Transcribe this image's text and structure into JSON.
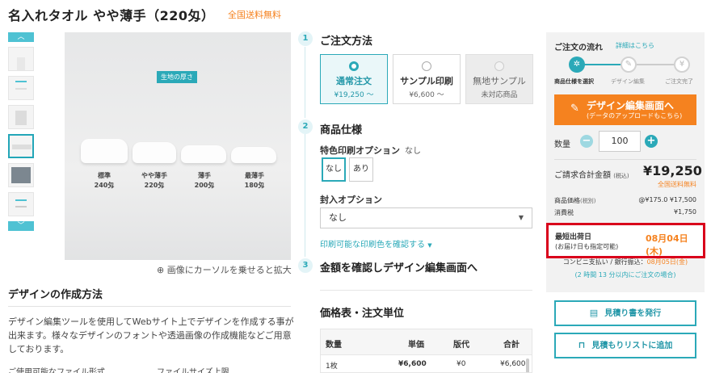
{
  "title": "名入れタオル やや薄手（220匁）",
  "free_shipping": "全国送料無料",
  "thumbnails": {
    "up": "︿",
    "down": "﹀"
  },
  "image": {
    "label": "生地の厚さ",
    "towels": [
      {
        "name": "標準",
        "weight": "240匁"
      },
      {
        "name": "やや薄手",
        "weight": "220匁"
      },
      {
        "name": "薄手",
        "weight": "200匁"
      },
      {
        "name": "最薄手",
        "weight": "180匁"
      }
    ],
    "zoom_hint": "画像にカーソルを乗せると拡大"
  },
  "design": {
    "title": "デザインの作成方法",
    "text": "デザイン編集ツールを使用してWebサイト上でデザインを作成する事が出来ます。様々なデザインのフォントや透過画像の作成機能などご用意しております。",
    "formats_label": "ご使用可能なファイル形式",
    "size_label": "ファイルサイズ上限"
  },
  "steps": [
    {
      "num": "1",
      "title": "ご注文方法"
    },
    {
      "num": "2",
      "title": "商品仕様"
    },
    {
      "num": "3",
      "title": "金額を確認しデザイン編集画面へ"
    }
  ],
  "order_methods": [
    {
      "name": "通常注文",
      "price": "¥19,250 〜"
    },
    {
      "name": "サンプル印刷",
      "price": "¥6,600 〜"
    },
    {
      "name": "無地サンプル",
      "price": "未対応商品"
    }
  ],
  "special_print": {
    "label": "特色印刷オプション",
    "note": "なし",
    "options": [
      "なし",
      "あり"
    ]
  },
  "enclose": {
    "label": "封入オプション",
    "value": "なし"
  },
  "color_link": "印刷可能な印刷色を確認する",
  "price_table": {
    "title": "価格表・注文単位",
    "headers": [
      "数量",
      "単価",
      "版代",
      "合計"
    ],
    "rows": [
      [
        "1枚",
        "¥6,600",
        "¥0",
        "¥6,600"
      ]
    ]
  },
  "flow": {
    "title": "ご注文の流れ",
    "link": "詳細はこちら",
    "steps": [
      "商品仕様を選択",
      "デザイン編集",
      "ご注文完了"
    ],
    "icons": [
      "✲",
      "✎",
      "¥"
    ]
  },
  "design_button": {
    "line1": "デザイン編集画面へ",
    "line2": "(データのアップロードもこちら)",
    "icon": "✎"
  },
  "quantity": {
    "label": "数量",
    "value": "100",
    "minus": "−",
    "plus": "+"
  },
  "total": {
    "label": "ご請求合計金額",
    "tax": "(税込)",
    "value": "¥19,250",
    "shipping": "全国送料無料"
  },
  "price_item": {
    "label": "商品価格",
    "tax": "(税別)",
    "value": "@¥175.0 ¥17,500"
  },
  "consumption_tax": {
    "label": "消費税",
    "value": "¥1,750"
  },
  "shipping_date": {
    "label": "最短出荷日",
    "sub": "(お届け日も指定可能)",
    "date": "08月04日(木)"
  },
  "conv": {
    "text": "コンビニ支払い / 銀行振込：",
    "date": "08月05日(金)",
    "note": "(2 時間 13 分以内にご注文の場合)"
  },
  "buttons": {
    "estimate": "見積り書を発行",
    "list": "見積もりリストに追加",
    "estimate_icon": "▤",
    "list_icon": "⊓"
  },
  "colors": {
    "accent": "#2ba9b8",
    "orange": "#f5821f",
    "highlight": "#d9001b"
  }
}
